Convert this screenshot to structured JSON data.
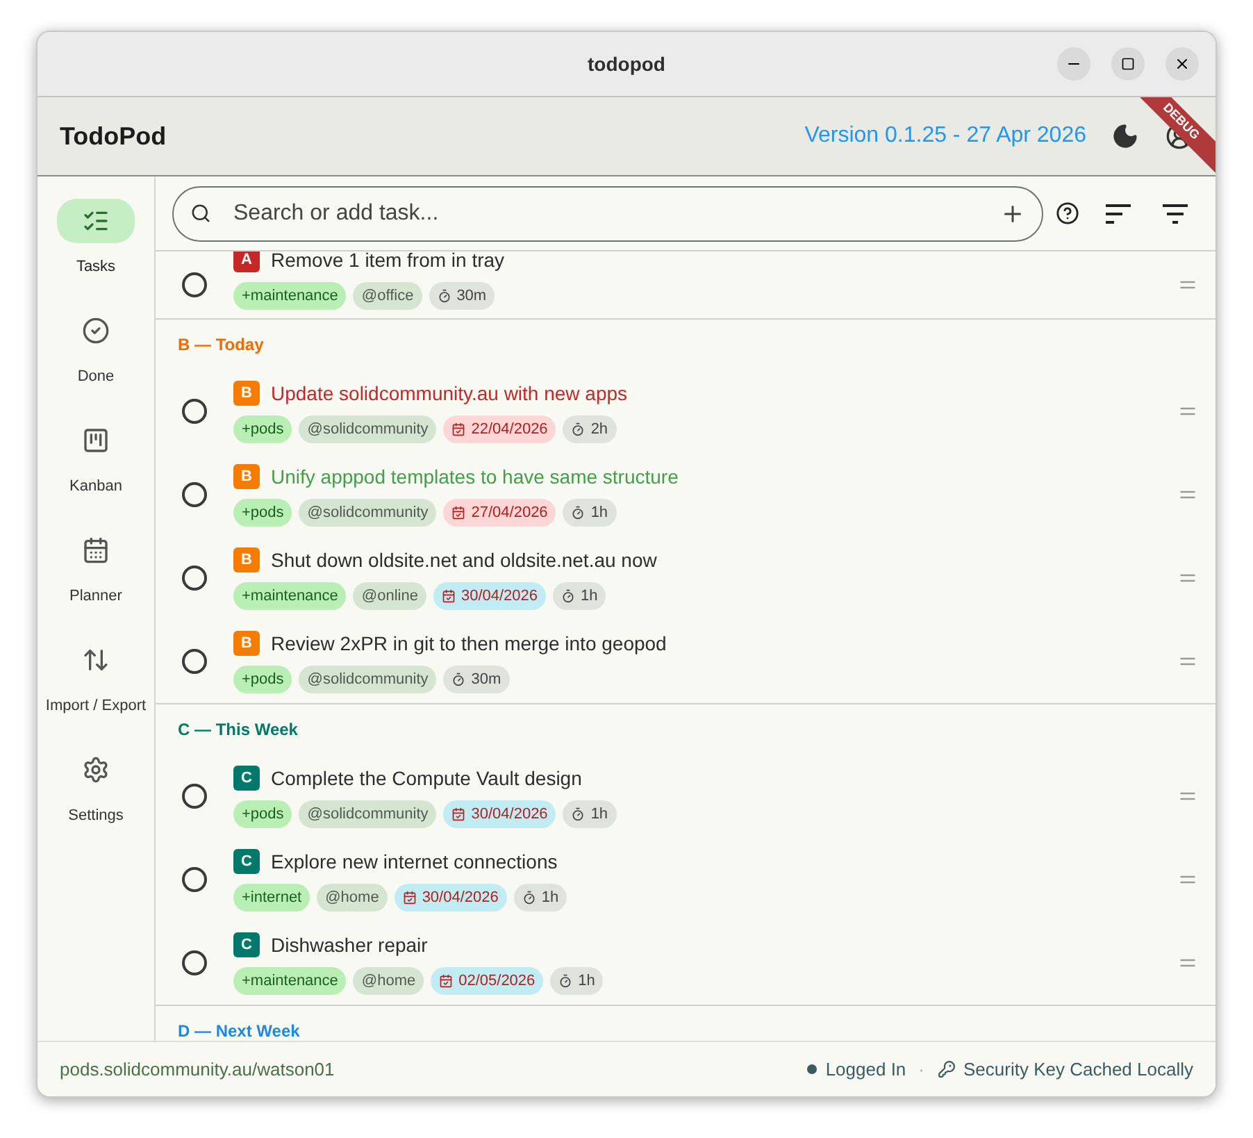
{
  "window": {
    "title": "todopod"
  },
  "app_bar": {
    "title": "TodoPod",
    "version": "Version 0.1.25 - 27 Apr 2026",
    "debug_banner": "DEBUG"
  },
  "sidebar": {
    "items": [
      {
        "label": "Tasks",
        "kind": "tasks",
        "selected": true
      },
      {
        "label": "Done",
        "kind": "done",
        "selected": false
      },
      {
        "label": "Kanban",
        "kind": "kanban",
        "selected": false
      },
      {
        "label": "Planner",
        "kind": "planner",
        "selected": false
      },
      {
        "label": "Import / Export",
        "kind": "transfer",
        "selected": false
      },
      {
        "label": "Settings",
        "kind": "settings",
        "selected": false
      }
    ]
  },
  "search": {
    "placeholder": "Search or add task..."
  },
  "sections": [
    {
      "tasks": [
        {
          "priority": "A",
          "title": "Remove 1 item from in tray",
          "done": false,
          "tags": [
            {
              "kind": "project",
              "text": "+maintenance"
            },
            {
              "kind": "context",
              "text": "@office"
            },
            {
              "kind": "estimate",
              "text": "30m"
            }
          ]
        }
      ]
    },
    {
      "heading": "B — Today",
      "color": "#ef6c00",
      "tasks": [
        {
          "priority": "B",
          "title": "Update solidcommunity.au with new apps",
          "done": false,
          "color": "#c62828",
          "tags": [
            {
              "kind": "project",
              "text": "+pods"
            },
            {
              "kind": "context",
              "text": "@solidcommunity"
            },
            {
              "kind": "due",
              "text": "22/04/2026",
              "overdue": true
            },
            {
              "kind": "estimate",
              "text": "2h"
            }
          ]
        },
        {
          "priority": "B",
          "title": "Unify apppod templates to have same structure",
          "done": false,
          "color": "#43a047",
          "tags": [
            {
              "kind": "project",
              "text": "+pods"
            },
            {
              "kind": "context",
              "text": "@solidcommunity"
            },
            {
              "kind": "due",
              "text": "27/04/2026",
              "overdue": true
            },
            {
              "kind": "estimate",
              "text": "1h"
            }
          ]
        },
        {
          "priority": "B",
          "title": "Shut down oldsite.net and oldsite.net.au now",
          "done": false,
          "tags": [
            {
              "kind": "project",
              "text": "+maintenance"
            },
            {
              "kind": "context",
              "text": "@online"
            },
            {
              "kind": "due",
              "text": "30/04/2026",
              "overdue": false
            },
            {
              "kind": "estimate",
              "text": "1h"
            }
          ]
        },
        {
          "priority": "B",
          "title": "Review 2xPR in git to then merge into geopod",
          "done": false,
          "tags": [
            {
              "kind": "project",
              "text": "+pods"
            },
            {
              "kind": "context",
              "text": "@solidcommunity"
            },
            {
              "kind": "estimate",
              "text": "30m"
            }
          ]
        }
      ]
    },
    {
      "heading": "C — This Week",
      "color": "#00796b",
      "tasks": [
        {
          "priority": "C",
          "title": "Complete the Compute Vault design",
          "done": false,
          "tags": [
            {
              "kind": "project",
              "text": "+pods"
            },
            {
              "kind": "context",
              "text": "@solidcommunity"
            },
            {
              "kind": "due",
              "text": "30/04/2026",
              "overdue": false
            },
            {
              "kind": "estimate",
              "text": "1h"
            }
          ]
        },
        {
          "priority": "C",
          "title": "Explore new internet connections",
          "done": false,
          "tags": [
            {
              "kind": "project",
              "text": "+internet"
            },
            {
              "kind": "context",
              "text": "@home"
            },
            {
              "kind": "due",
              "text": "30/04/2026",
              "overdue": false
            },
            {
              "kind": "estimate",
              "text": "1h"
            }
          ]
        },
        {
          "priority": "C",
          "title": "Dishwasher repair",
          "done": false,
          "tags": [
            {
              "kind": "project",
              "text": "+maintenance"
            },
            {
              "kind": "context",
              "text": "@home"
            },
            {
              "kind": "due",
              "text": "02/05/2026",
              "overdue": false
            },
            {
              "kind": "estimate",
              "text": "1h"
            }
          ]
        }
      ]
    },
    {
      "heading": "D — Next Week",
      "color": "#1e88e5"
    }
  ],
  "status_bar": {
    "pod": "pods.solidcommunity.au/watson01",
    "login": "Logged In",
    "separator": "·",
    "key": "Security Key Cached Locally"
  }
}
